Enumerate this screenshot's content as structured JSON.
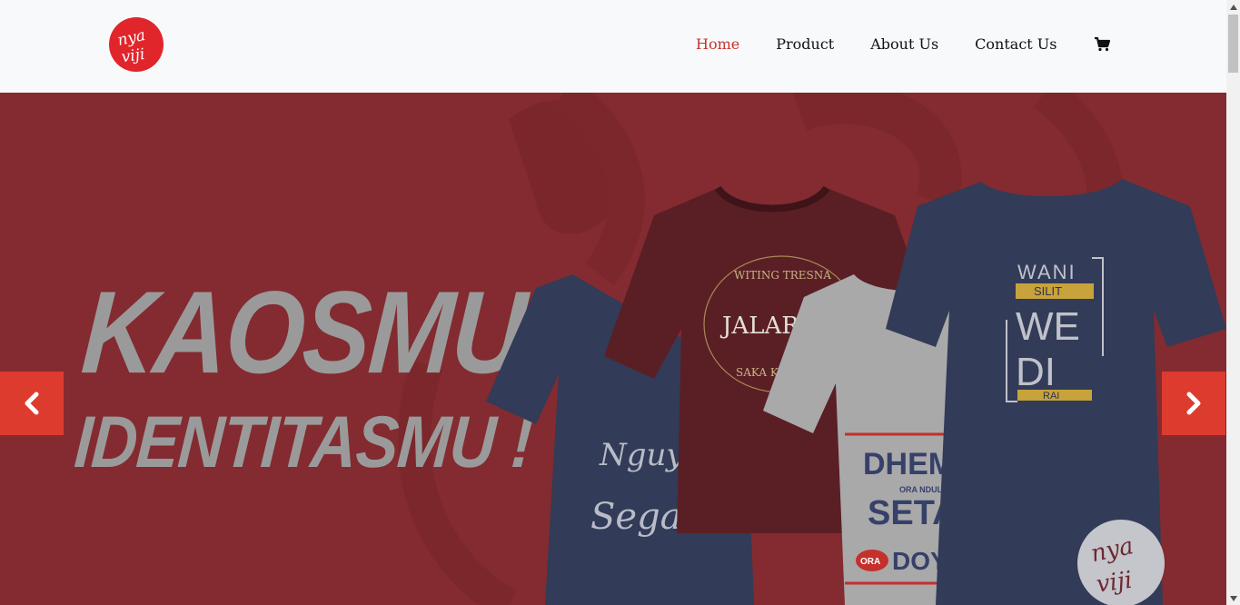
{
  "brand": {
    "name": "nyaviji",
    "color": "#e0262b"
  },
  "nav": {
    "items": [
      {
        "label": "Home",
        "active": true
      },
      {
        "label": "Product",
        "active": false
      },
      {
        "label": "About Us",
        "active": false
      },
      {
        "label": "Contact Us",
        "active": false
      }
    ],
    "cart_icon": "shopping-cart-icon"
  },
  "hero": {
    "line1": "KAOSMU",
    "line2": "IDENTITASMU !",
    "background_color": "#832b30",
    "text_color": "#9a9a9b",
    "shirt_texts": {
      "maroon_shirt": [
        "WITING TRESNA",
        "JALARAN",
        "SAKA KULINA"
      ],
      "left_navy_shirt": [
        "Nguyah",
        "Sega"
      ],
      "grey_shirt": [
        "DHEMIT",
        "ORA NDULIT",
        "SETAN",
        "ORA",
        "DOYAN"
      ],
      "right_navy_shirt": [
        "WANI",
        "SILIT",
        "WE",
        "DI",
        "RAI"
      ]
    },
    "prev_icon": "chevron-left-icon",
    "next_icon": "chevron-right-icon",
    "arrow_color": "#de3b2f"
  },
  "accent_color": "#c8322c"
}
